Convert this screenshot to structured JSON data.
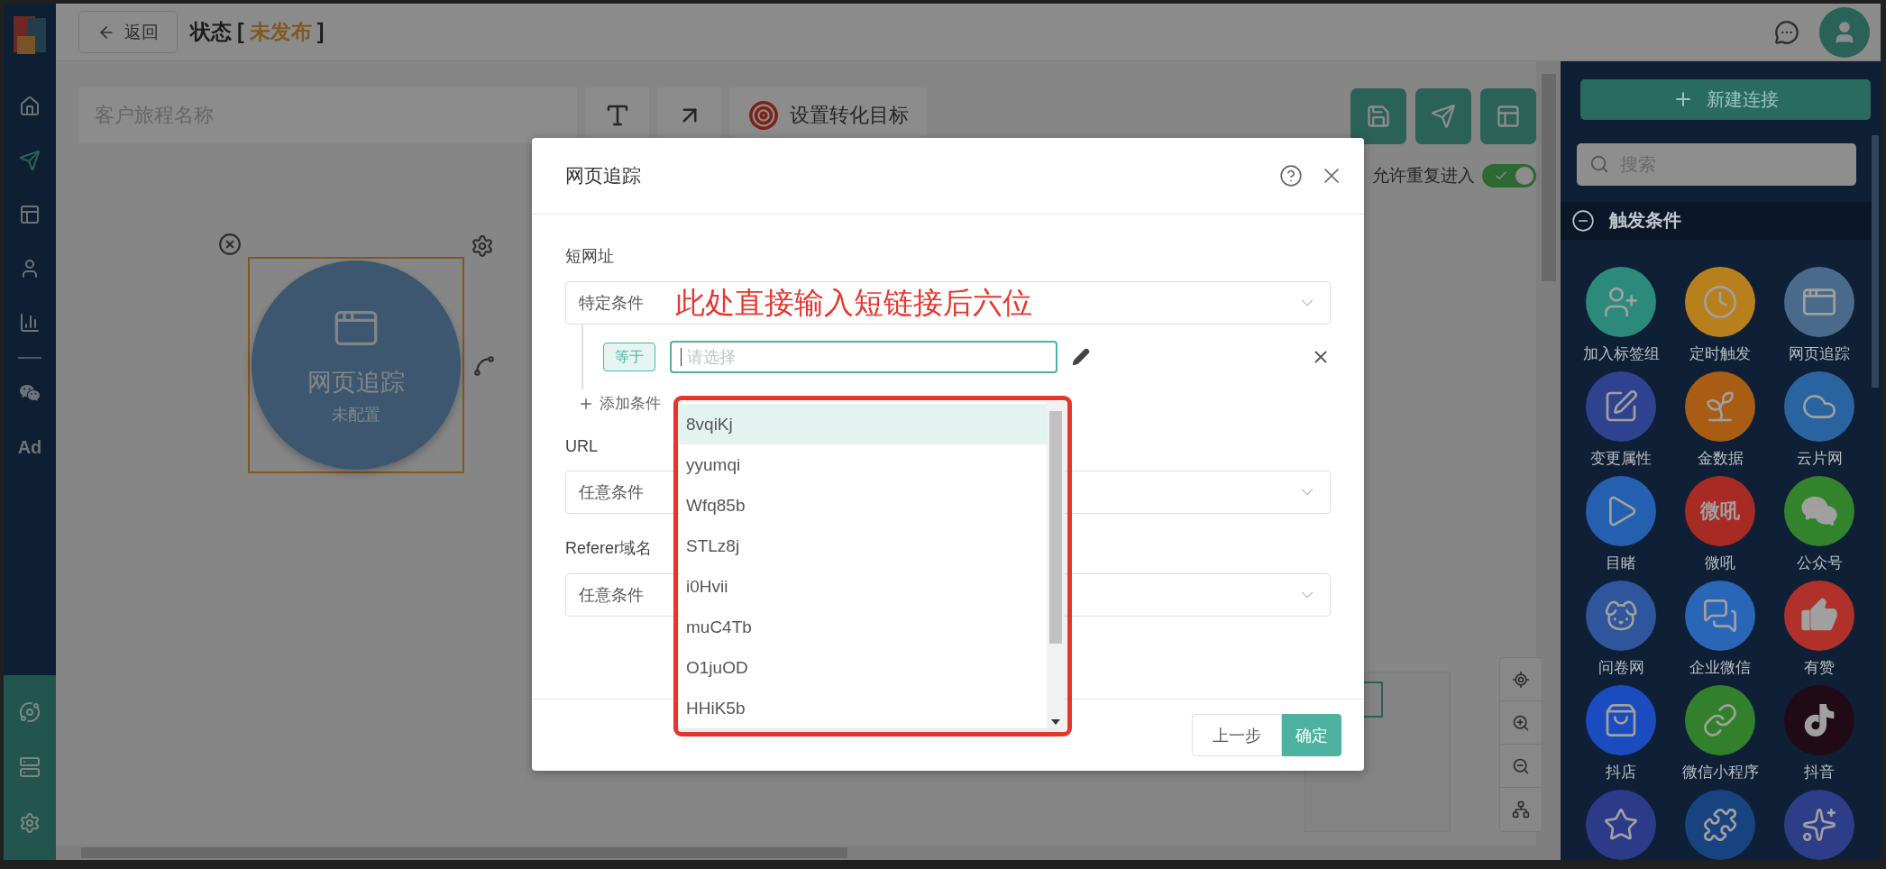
{
  "sidebar": {
    "nav": [
      {
        "selected": false
      },
      {
        "selected": true
      },
      {
        "selected": false
      },
      {
        "selected": false
      },
      {
        "selected": false
      },
      {
        "selected": false
      },
      {
        "label": "Ad",
        "selected": false
      }
    ]
  },
  "header": {
    "back": "返回",
    "title": "状态",
    "bracket_open": "[",
    "status": "未发布",
    "bracket_close": "]"
  },
  "canvas": {
    "name_placeholder": "客户旅程名称",
    "goal_button": "设置转化目标",
    "repeat": {
      "label": "允许重复进入",
      "on": true
    },
    "node": {
      "title": "网页追踪",
      "subtitle": "未配置",
      "selected": true
    }
  },
  "modal": {
    "title": "网页追踪",
    "sections": [
      {
        "label": "短网址",
        "select": "特定条件",
        "conditions": [
          {
            "operator": "等于",
            "placeholder": "请选择"
          }
        ],
        "add": "添加条件"
      },
      {
        "label": "URL",
        "select": "任意条件"
      },
      {
        "label": "Referer域名",
        "select": "任意条件"
      }
    ],
    "annotation": "此处直接输入短链接后六位",
    "dropdown": {
      "options": [
        {
          "label": "8vqiKj",
          "selected": true
        },
        {
          "label": "yyumqi",
          "selected": false
        },
        {
          "label": "Wfq85b",
          "selected": false
        },
        {
          "label": "STLz8j",
          "selected": false
        },
        {
          "label": "i0Hvii",
          "selected": false
        },
        {
          "label": "muC4Tb",
          "selected": false
        },
        {
          "label": "O1juOD",
          "selected": false
        },
        {
          "label": "HHiK5b",
          "selected": false
        }
      ]
    },
    "buttons": [
      {
        "label": "上一步",
        "kind": "secondary"
      },
      {
        "label": "确定",
        "kind": "primary"
      }
    ]
  },
  "panel": {
    "new_button": "新建连接",
    "search_placeholder": "搜索",
    "section": {
      "title": "触发条件",
      "expanded": true
    },
    "items": [
      {
        "label": "加入标签组",
        "color": "#2c8a7c"
      },
      {
        "label": "定时触发",
        "color": "#b8801c"
      },
      {
        "label": "网页追踪",
        "color": "#4a6a8c"
      },
      {
        "label": "变更属性",
        "color": "#2e4290"
      },
      {
        "label": "金数据",
        "color": "#a85c14"
      },
      {
        "label": "云片网",
        "color": "#2a64a0"
      },
      {
        "label": "目睹",
        "color": "#2560b0"
      },
      {
        "label": "微吼",
        "color": "#a82a24",
        "text_logo": true
      },
      {
        "label": "公众号",
        "color": "#33832c"
      },
      {
        "label": "问卷网",
        "color": "#2f559c"
      },
      {
        "label": "企业微信",
        "color": "#2a66b8"
      },
      {
        "label": "有赞",
        "color": "#b0302a"
      },
      {
        "label": "抖店",
        "color": "#1a4cc0"
      },
      {
        "label": "微信小程序",
        "color": "#33802c"
      },
      {
        "label": "抖音",
        "color": "#200a16"
      },
      {
        "color": "#2c3a8a"
      },
      {
        "color": "#174380"
      },
      {
        "color": "#2e3d88"
      }
    ],
    "logo_text": "微吼"
  }
}
